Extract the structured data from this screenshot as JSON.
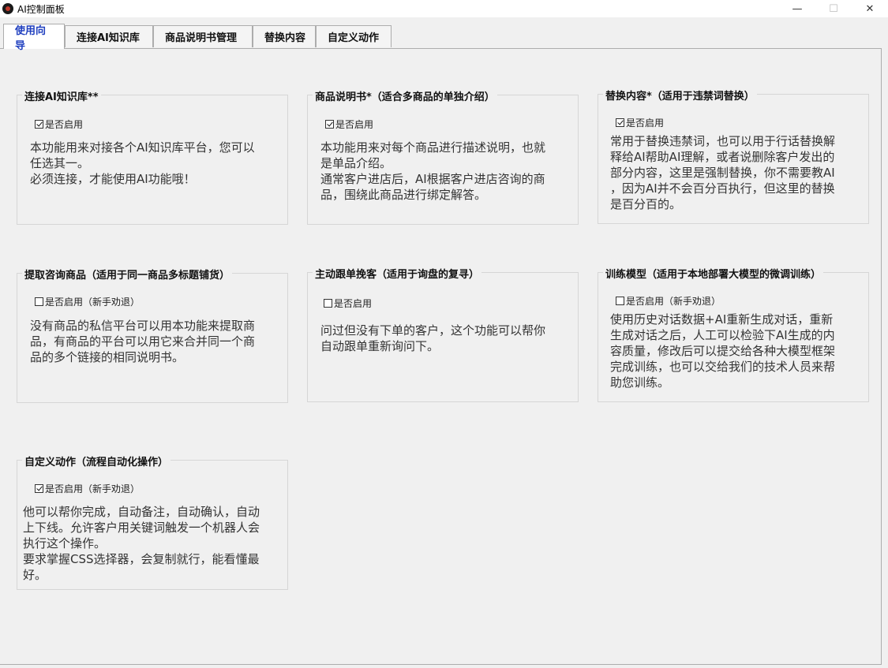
{
  "window": {
    "title": "AI控制面板",
    "minimize": "—",
    "maximize": "☐",
    "close": "✕"
  },
  "tabs": [
    {
      "label": "使用向导",
      "active": true
    },
    {
      "label": "连接AI知识库",
      "active": false
    },
    {
      "label": "商品说明书管理",
      "active": false
    },
    {
      "label": "替换内容",
      "active": false
    },
    {
      "label": "自定义动作",
      "active": false
    }
  ],
  "groups": {
    "knowledge": {
      "title": "连接AI知识库**",
      "checkbox_label": "是否启用",
      "checked": true,
      "description": "本功能用来对接各个AI知识库平台，您可以\n任选其一。\n必须连接，才能使用AI功能哦！"
    },
    "manual": {
      "title": "商品说明书*（适合多商品的单独介绍）",
      "checkbox_label": "是否启用",
      "checked": true,
      "description": "本功能用来对每个商品进行描述说明，也就\n是单品介绍。\n通常客户进店后，AI根据客户进店咨询的商\n品，围绕此商品进行绑定解答。"
    },
    "replace": {
      "title": "替换内容*（适用于违禁词替换）",
      "checkbox_label": "是否启用",
      "checked": true,
      "description": "常用于替换违禁词，也可以用于行话替换解\n释给AI帮助AI理解，或者说删除客户发出的\n部分内容，这里是强制替换，你不需要教AI\n，因为AI并不会百分百执行，但这里的替换\n是百分百的。"
    },
    "extract": {
      "title": "提取咨询商品（适用于同一商品多标题铺货）",
      "checkbox_label": "是否启用（新手劝退）",
      "checked": false,
      "description": "没有商品的私信平台可以用本功能来提取商\n品，有商品的平台可以用它来合并同一个商\n品的多个链接的相同说明书。"
    },
    "followup": {
      "title": "主动跟单挽客（适用于询盘的复寻）",
      "checkbox_label": "是否启用",
      "checked": false,
      "description": "问过但没有下单的客户，这个功能可以帮你\n自动跟单重新询问下。"
    },
    "training": {
      "title": "训练模型（适用于本地部署大模型的微调训练）",
      "checkbox_label": "是否启用（新手劝退）",
      "checked": false,
      "description": "使用历史对话数据+AI重新生成对话，重新\n生成对话之后，人工可以检验下AI生成的内\n容质量，修改后可以提交给各种大模型框架\n完成训练，也可以交给我们的技术人员来帮\n助您训练。"
    },
    "custom": {
      "title": "自定义动作（流程自动化操作）",
      "checkbox_label": "是否启用（新手劝退）",
      "checked": true,
      "description": "他可以帮你完成，自动备注，自动确认，自动\n上下线。允许客户用关键词触发一个机器人会\n执行这个操作。\n要求掌握CSS选择器，会复制就行，能看懂最\n好。"
    }
  }
}
